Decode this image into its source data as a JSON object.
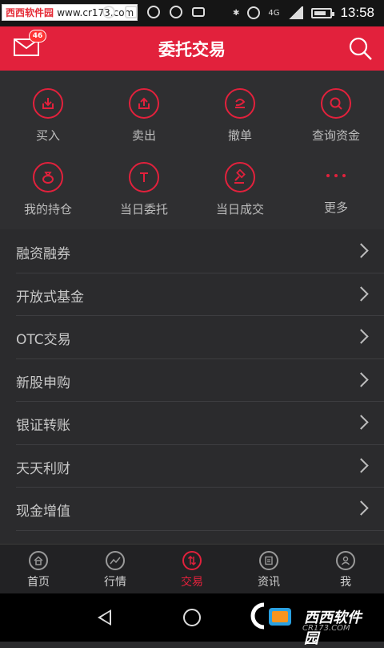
{
  "statusbar": {
    "watermark_name": "西西软件园",
    "watermark_site": "www.cr173.com",
    "network": "4G",
    "time": "13:58"
  },
  "header": {
    "title": "委托交易",
    "mail_badge": "46"
  },
  "grid": {
    "items": [
      {
        "label": "买入",
        "icon": "download-icon"
      },
      {
        "label": "卖出",
        "icon": "upload-icon"
      },
      {
        "label": "撤单",
        "icon": "undo-icon"
      },
      {
        "label": "查询资金",
        "icon": "search-money-icon"
      },
      {
        "label": "我的持仓",
        "icon": "bag-icon"
      },
      {
        "label": "当日委托",
        "icon": "t-icon"
      },
      {
        "label": "当日成交",
        "icon": "gavel-icon"
      },
      {
        "label": "更多",
        "icon": "more-dots-icon"
      }
    ]
  },
  "list": {
    "items": [
      {
        "label": "融资融券"
      },
      {
        "label": "开放式基金"
      },
      {
        "label": "OTC交易"
      },
      {
        "label": "新股申购"
      },
      {
        "label": "银证转账"
      },
      {
        "label": "天天利财"
      },
      {
        "label": "现金增值"
      }
    ]
  },
  "tabbar": {
    "tabs": [
      {
        "label": "首页",
        "icon": "home-icon"
      },
      {
        "label": "行情",
        "icon": "chart-icon"
      },
      {
        "label": "交易",
        "icon": "trade-icon",
        "active": true
      },
      {
        "label": "资讯",
        "icon": "news-icon"
      },
      {
        "label": "我",
        "icon": "user-icon"
      }
    ]
  },
  "navbar": {
    "logo_text": "西西软件园",
    "logo_sub": "CR173.COM"
  },
  "colors": {
    "accent": "#e2213c",
    "background": "#2b2b2d",
    "grid_background": "#2f2f31",
    "tabbar_background": "#222224"
  }
}
